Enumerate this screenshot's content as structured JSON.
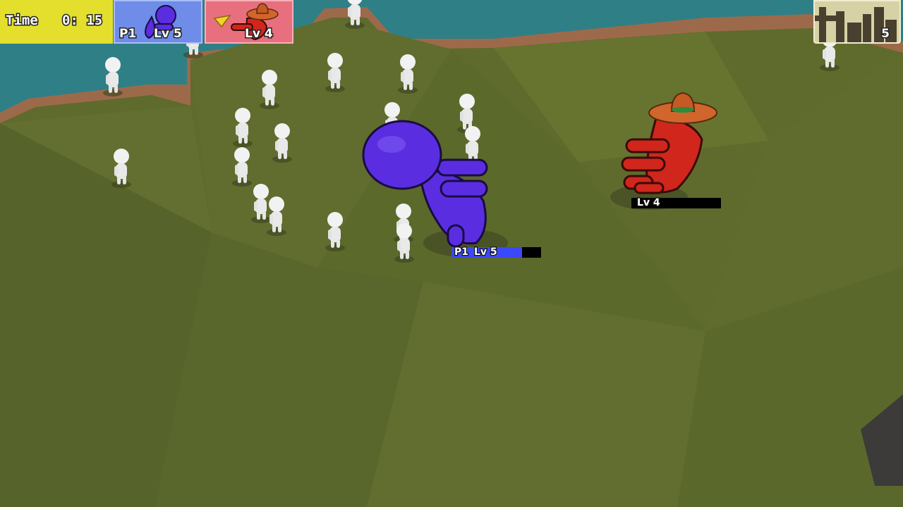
{
  "hud": {
    "time_label": "Time",
    "time_value": "0: 15",
    "players": [
      {
        "id": "P1",
        "level": "Lv 5",
        "color": "#6e8ce8",
        "character_color": "#5a2ee0"
      },
      {
        "id": "",
        "level": "Lv 4",
        "color": "#e86f7e",
        "character_color": "#d0261c"
      }
    ],
    "rank_value": "5"
  },
  "characters": {
    "player": {
      "tag_id": "P1",
      "tag_level": "Lv 5",
      "color": "#5a2ee0"
    },
    "rival": {
      "tag_level": "Lv 4",
      "color": "#d0261c",
      "hat_color": "#d0662c"
    }
  },
  "colors": {
    "water": "#2f7f86",
    "grass": "#5c6a2c",
    "shore": "#9c6a4a",
    "npc": "#f2f2f2"
  },
  "icons": [
    "player-avatar-icon",
    "rival-avatar-icon",
    "leader-flag-icon",
    "city-skyline-icon"
  ]
}
